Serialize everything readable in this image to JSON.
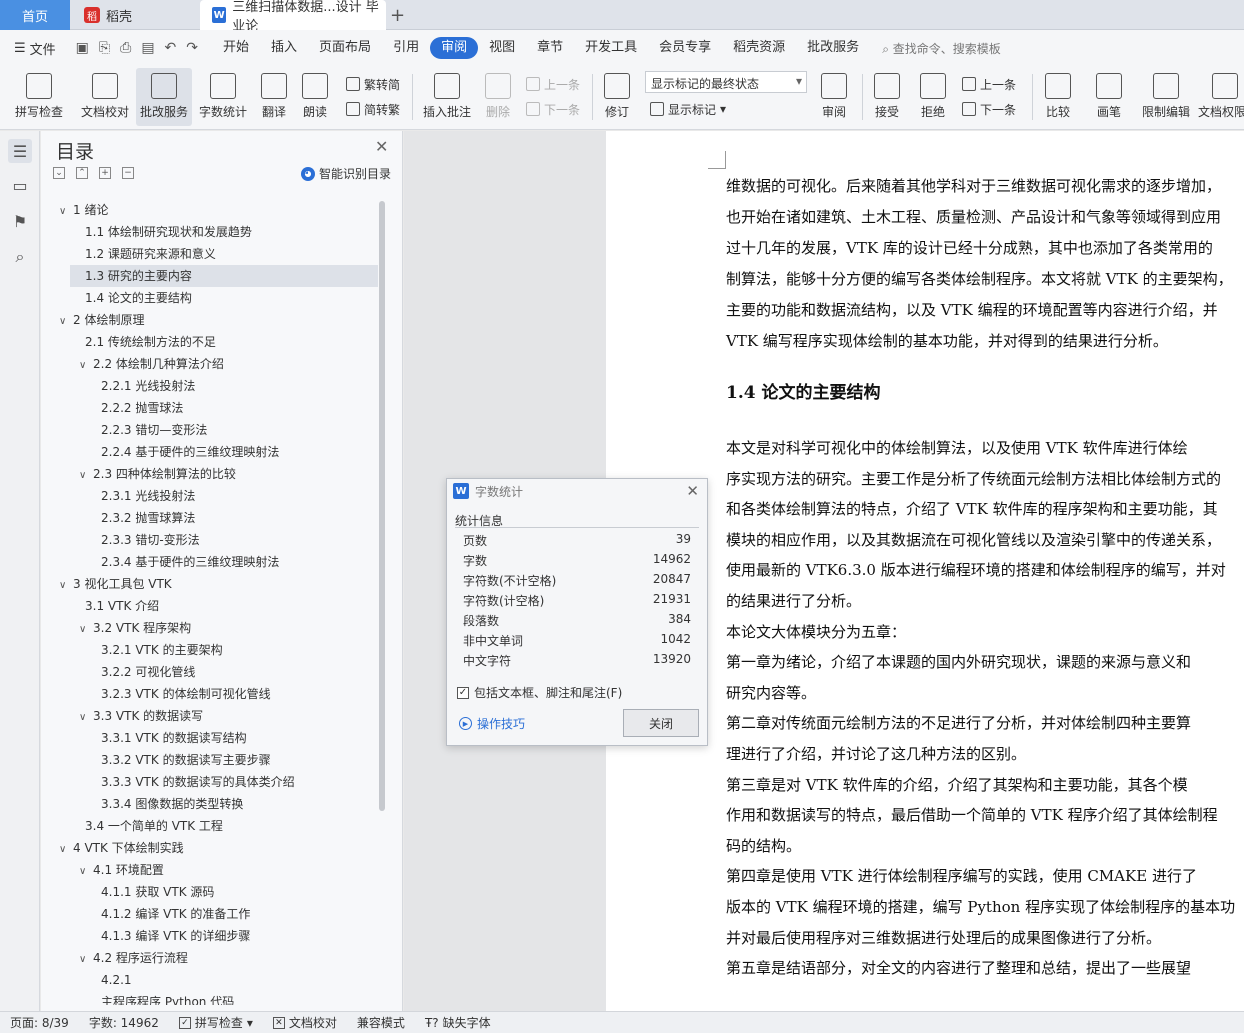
{
  "tabs": {
    "home": "首页",
    "daoke": "稻壳",
    "doc": "三维扫描体数据...设计 毕业论"
  },
  "menu": {
    "file": "文件",
    "tabs": [
      "开始",
      "插入",
      "页面布局",
      "引用",
      "审阅",
      "视图",
      "章节",
      "开发工具",
      "会员专享",
      "稻壳资源",
      "批改服务"
    ],
    "search": "查找命令、搜索模板"
  },
  "ribbon": {
    "spell": "拼写检查",
    "proof": "文档校对",
    "review_service": "批改服务",
    "word_count": "字数统计",
    "translate": "翻译",
    "read_aloud": "朗读",
    "trad": "繁转简",
    "simp": "简转繁",
    "insert_comment": "插入批注",
    "delete": "删除",
    "prev": "上一条",
    "next": "下一条",
    "track": "修订",
    "markup_mode": "显示标记的最终状态",
    "show_markup": "显示标记",
    "review": "审阅",
    "accept": "接受",
    "reject": "拒绝",
    "prev2": "上一条",
    "next2": "下一条",
    "compare": "比较",
    "ink": "画笔",
    "restrict": "限制编辑",
    "doc_perm": "文档权限"
  },
  "toc": {
    "title": "目录",
    "smart": "智能识别目录",
    "items": [
      {
        "text": "1  绪论",
        "level": 1,
        "caret": true
      },
      {
        "text": "1.1  体绘制研究现状和发展趋势",
        "level": 2
      },
      {
        "text": "1.2  课题研究来源和意义",
        "level": 2
      },
      {
        "text": "1.3  研究的主要内容",
        "level": 2,
        "active": true
      },
      {
        "text": "1.4  论文的主要结构",
        "level": 2
      },
      {
        "text": "2  体绘制原理",
        "level": 1,
        "caret": true
      },
      {
        "text": "2.1 传统绘制方法的不足",
        "level": 2
      },
      {
        "text": "2.2  体绘制几种算法介绍",
        "level": 2,
        "caret": true
      },
      {
        "text": "2.2.1  光线投射法",
        "level": 3
      },
      {
        "text": "2.2.2  抛雪球法",
        "level": 3
      },
      {
        "text": "2.2.3  错切—变形法",
        "level": 3
      },
      {
        "text": "2.2.4 基于硬件的三维纹理映射法",
        "level": 3
      },
      {
        "text": "2.3  四种体绘制算法的比较",
        "level": 2,
        "caret": true
      },
      {
        "text": "2.3.1  光线投射法",
        "level": 3
      },
      {
        "text": "2.3.2  抛雪球算法",
        "level": 3
      },
      {
        "text": "2.3.3  错切-变形法",
        "level": 3
      },
      {
        "text": "2.3.4  基于硬件的三维纹理映射法",
        "level": 3
      },
      {
        "text": "3  视化工具包 VTK",
        "level": 1,
        "caret": true
      },
      {
        "text": "3.1 VTK 介绍",
        "level": 2
      },
      {
        "text": "3.2 VTK 程序架构",
        "level": 2,
        "caret": true
      },
      {
        "text": "3.2.1 VTK 的主要架构",
        "level": 3
      },
      {
        "text": "3.2.2  可视化管线",
        "level": 3
      },
      {
        "text": "3.2.3 VTK 的体绘制可视化管线",
        "level": 3
      },
      {
        "text": "3.3 VTK 的数据读写",
        "level": 2,
        "caret": true
      },
      {
        "text": "3.3.1 VTK 的数据读写结构",
        "level": 3
      },
      {
        "text": "3.3.2 VTK 的数据读写主要步骤",
        "level": 3
      },
      {
        "text": "3.3.3 VTK 的数据读写的具体类介绍",
        "level": 3
      },
      {
        "text": "3.3.4  图像数据的类型转换",
        "level": 3
      },
      {
        "text": "3.4  一个简单的 VTK 工程",
        "level": 2
      },
      {
        "text": "4 VTK 下体绘制实践",
        "level": 1,
        "caret": true
      },
      {
        "text": "4.1  环境配置",
        "level": 2,
        "caret": true
      },
      {
        "text": "4.1.1  获取 VTK 源码",
        "level": 3
      },
      {
        "text": "4.1.2  编译 VTK 的准备工作",
        "level": 3
      },
      {
        "text": "4.1.3  编译 VTK 的详细步骤",
        "level": 3
      },
      {
        "text": "4.2  程序运行流程",
        "level": 2,
        "caret": true
      },
      {
        "text": "4.2.1",
        "level": 3
      },
      {
        "text": "主程序程序 Python 代码",
        "level": 3
      }
    ]
  },
  "doc": {
    "lines": [
      "维数据的可视化。后来随着其他学科对于三维数据可视化需求的逐步增加，",
      "也开始在诸如建筑、土木工程、质量检测、产品设计和气象等领域得到应用",
      "过十几年的发展，VTK 库的设计已经十分成熟，其中也添加了各类常用的",
      "制算法，能够十分方便的编写各类体绘制程序。本文将就 VTK 的主要架构，",
      "主要的功能和数据流结构，以及 VTK 编程的环境配置等内容进行介绍，并",
      "VTK 编写程序实现体绘制的基本功能，并对得到的结果进行分析。"
    ],
    "heading": "1.4  论文的主要结构",
    "lines2": [
      "      本文是对科学可视化中的体绘制算法，以及使用 VTK 软件库进行体绘",
      "序实现方法的研究。主要工作是分析了传统面元绘制方法相比体绘制方式的",
      "和各类体绘制算法的特点，介绍了 VTK 软件库的程序架构和主要功能，其",
      "模块的相应作用，以及其数据流在可视化管线以及渲染引擎中的传递关系，",
      "使用最新的 VTK6.3.0 版本进行编程环境的搭建和体绘制程序的编写，并对",
      "的结果进行了分析。",
      "      本论文大体模块分为五章：",
      "      第一章为绪论，介绍了本课题的国内外研究现状，课题的来源与意义和",
      "研究内容等。",
      "      第二章对传统面元绘制方法的不足进行了分析，并对体绘制四种主要算",
      "理进行了介绍，并讨论了这几种方法的区别。",
      "      第三章是对 VTK 软件库的介绍，介绍了其架构和主要功能，其各个模",
      "作用和数据读写的特点，最后借助一个简单的 VTK 程序介绍了其体绘制程",
      "码的结构。",
      "      第四章是使用 VTK 进行体绘制程序编写的实践，使用 CMAKE 进行了",
      "版本的 VTK 编程环境的搭建，编写 Python 程序实现了体绘制程序的基本功",
      "并对最后使用程序对三维数据进行处理后的成果图像进行了分析。",
      "      第五章是结语部分，对全文的内容进行了整理和总结，提出了一些展望"
    ]
  },
  "dialog": {
    "title": "字数统计",
    "group": "统计信息",
    "rows": [
      {
        "label": "页数",
        "value": "39"
      },
      {
        "label": "字数",
        "value": "14962"
      },
      {
        "label": "字符数(不计空格)",
        "value": "20847"
      },
      {
        "label": "字符数(计空格)",
        "value": "21931"
      },
      {
        "label": "段落数",
        "value": "384"
      },
      {
        "label": "非中文单词",
        "value": "1042"
      },
      {
        "label": "中文字符",
        "value": "13920"
      }
    ],
    "include": "包括文本框、脚注和尾注(F)",
    "tips": "操作技巧",
    "close": "关闭"
  },
  "status": {
    "page": "页面: 8/39",
    "words": "字数: 14962",
    "spell": "拼写检查",
    "proof": "文档校对",
    "compat": "兼容模式",
    "missing_font": "缺失字体"
  }
}
